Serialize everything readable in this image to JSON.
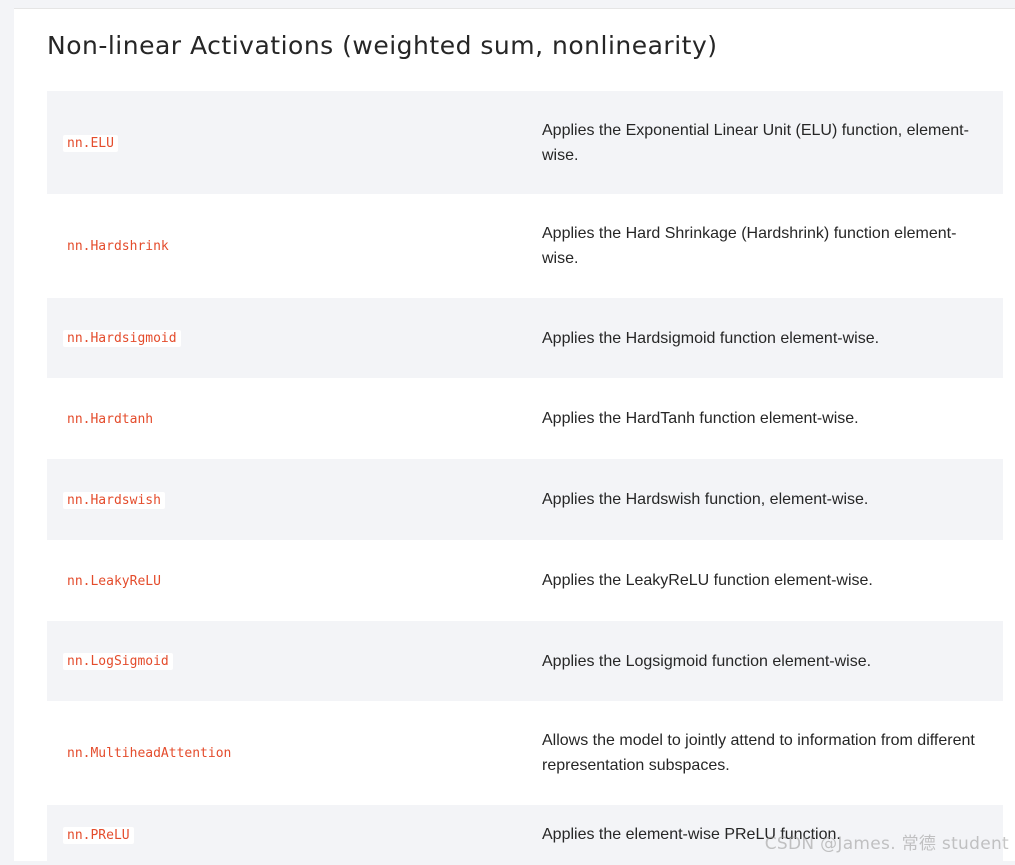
{
  "section": {
    "title": "Non-linear Activations (weighted sum, nonlinearity)"
  },
  "rows": [
    {
      "name": "nn.ELU",
      "description": "Applies the Exponential Linear Unit (ELU) function, element-wise."
    },
    {
      "name": "nn.Hardshrink",
      "description": "Applies the Hard Shrinkage (Hardshrink) function element-wise."
    },
    {
      "name": "nn.Hardsigmoid",
      "description": "Applies the Hardsigmoid function element-wise."
    },
    {
      "name": "nn.Hardtanh",
      "description": "Applies the HardTanh function element-wise."
    },
    {
      "name": "nn.Hardswish",
      "description": "Applies the Hardswish function, element-wise."
    },
    {
      "name": "nn.LeakyReLU",
      "description": "Applies the LeakyReLU function element-wise."
    },
    {
      "name": "nn.LogSigmoid",
      "description": "Applies the Logsigmoid function element-wise."
    },
    {
      "name": "nn.MultiheadAttention",
      "description": "Allows the model to jointly attend to information from different representation subspaces."
    },
    {
      "name": "nn.PReLU",
      "description": "Applies the element-wise PReLU function."
    }
  ],
  "watermark": "CSDN @James. 常德 student",
  "colors": {
    "code_text": "#e44c2c",
    "stripe_bg": "#f3f4f7",
    "body_text": "#262626"
  }
}
